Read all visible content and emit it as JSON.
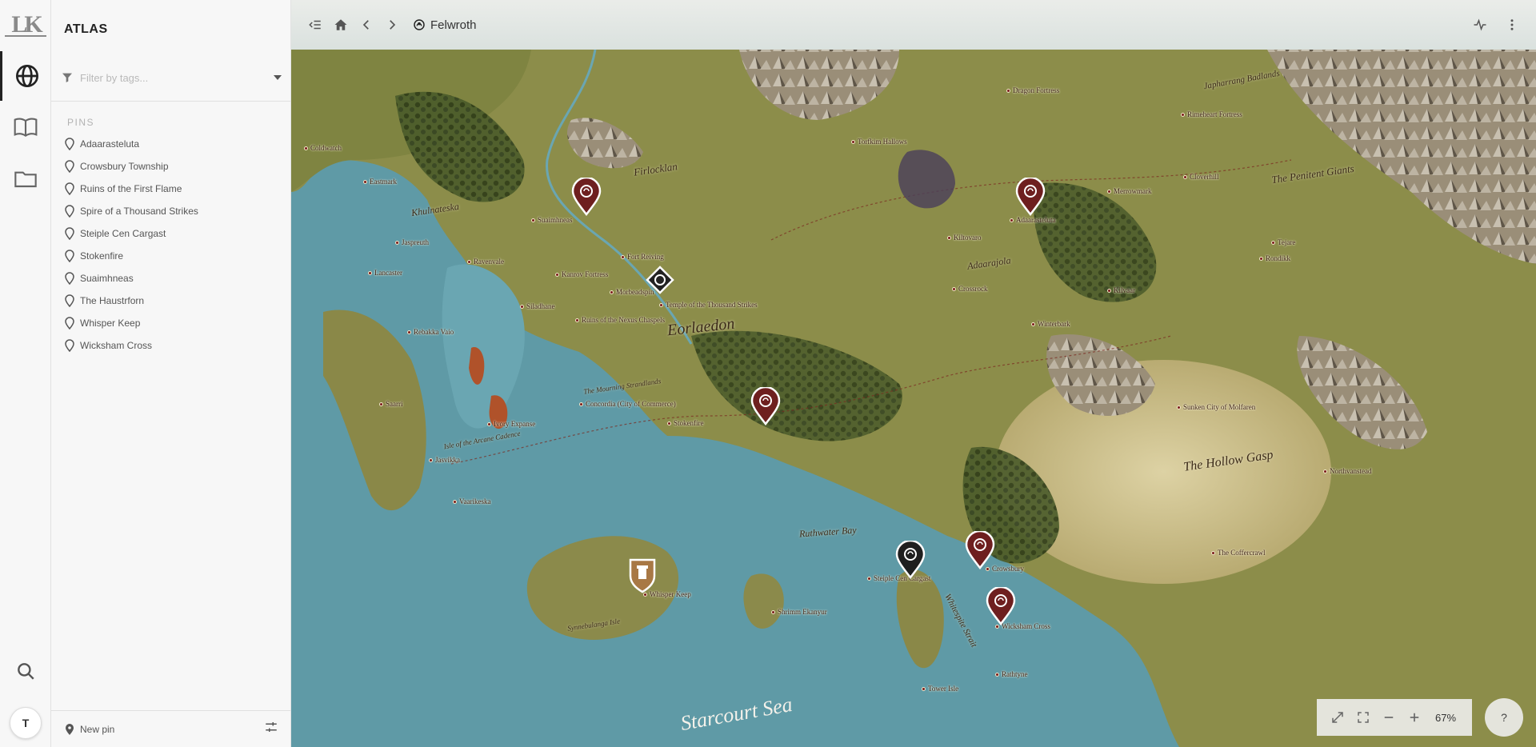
{
  "app": {
    "logo_text": "LK",
    "panel_title": "ATLAS",
    "user_initial": "T"
  },
  "rail": [
    {
      "name": "atlas",
      "icon": "globe-icon",
      "active": true
    },
    {
      "name": "journal",
      "icon": "book-icon",
      "active": false
    },
    {
      "name": "files",
      "icon": "folder-icon",
      "active": false
    }
  ],
  "filter": {
    "placeholder": "Filter by tags..."
  },
  "pins_section": {
    "label": "PINS",
    "items": [
      "Adaarasteluta",
      "Crowsbury Township",
      "Ruins of the First Flame",
      "Spire of a Thousand Strikes",
      "Steiple Cen Cargast",
      "Stokenfire",
      "Suaimhneas",
      "The Haustrforn",
      "Whisper Keep",
      "Wicksham Cross"
    ]
  },
  "footer": {
    "new_pin_label": "New pin"
  },
  "topbar": {
    "breadcrumb": "Felwroth"
  },
  "map": {
    "regions": [
      {
        "text": "Eorlaedon",
        "size": 20
      },
      {
        "text": "The Hollow Gasp",
        "size": 16
      },
      {
        "text": "Adaarajola",
        "size": 12
      },
      {
        "text": "Firlocklan",
        "size": 13
      },
      {
        "text": "Khulnateska",
        "size": 12
      },
      {
        "text": "The Penitent Giants",
        "size": 13
      },
      {
        "text": "Japharrang Badlands",
        "size": 11
      },
      {
        "text": "Isle of the Arcane Cadence",
        "size": 9
      },
      {
        "text": "The Mourning Strandlands",
        "size": 9
      },
      {
        "text": "Whitespite Strait",
        "size": 11
      },
      {
        "text": "Synnebulanga Isle",
        "size": 9
      },
      {
        "text": "Ruthwater Bay",
        "size": 12
      }
    ],
    "sea_label": "Starcourt Sea",
    "places": [
      "Stokenfire",
      "Suaimhneas",
      "Adaarasteluta",
      "Crowsbury",
      "Wicksham Cross",
      "Whisper Keep",
      "Steiple Cen Cargast",
      "Temple of the Thousand Strikes",
      "Ruins of the Nexus Chaspels",
      "Concordia (City of Commerce)",
      "Ivory Expanse",
      "Morbeadspin",
      "Fort Reiving",
      "Jasvikka",
      "Vaarikeska",
      "Kanrov Fortress",
      "Saarri",
      "Rebakka Vaio",
      "Siladhane",
      "Jaspreuth",
      "Lancaster",
      "Ravenvale",
      "Eastmark",
      "Kiltovaro",
      "Coldwatch",
      "The Coffercrawl",
      "Sunken City of Molfaren",
      "Crossrock",
      "Rimeheart Fortress",
      "Dragon Fortress",
      "Cloverhill",
      "Tejare",
      "Merrowmark",
      "Kilvaar",
      "Torfkim Hallows",
      "Northvanstead",
      "Shrimm Ekanyur",
      "Winterbark",
      "Tower Isle",
      "Rathtyne",
      "Rondikk"
    ]
  },
  "zoom": {
    "percent": "67%"
  },
  "help_label": "?"
}
